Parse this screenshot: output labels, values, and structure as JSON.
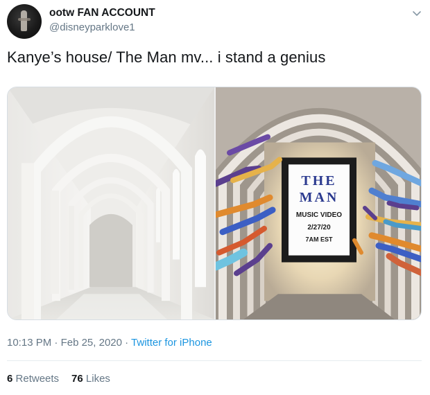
{
  "user": {
    "display_name": "ootw FAN ACCOUNT",
    "handle": "@disneyparklove1"
  },
  "tweet": {
    "text": "Kanye’s house/ The Man mv... i stand a genius"
  },
  "poster": {
    "line1": "THE",
    "line2": "MAN",
    "line3": "MUSIC VIDEO",
    "line4": "2/27/20",
    "line5": "7AM EST"
  },
  "meta": {
    "time": "10:13 PM",
    "separator1": " · ",
    "date": "Feb 25, 2020",
    "separator2": " · ",
    "source": "Twitter for iPhone"
  },
  "stats": {
    "retweets_count": "6",
    "retweets_label": "Retweets",
    "likes_count": "76",
    "likes_label": "Likes"
  },
  "icons": {
    "more": "chevron-down-icon"
  },
  "colors": {
    "link": "#1b95e0",
    "secondary_text": "#657786",
    "poster_blue": "#2b3a8f"
  }
}
